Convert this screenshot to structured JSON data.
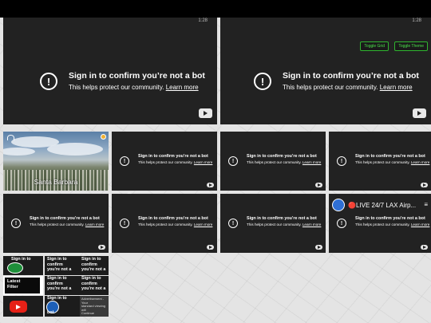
{
  "time_label": "1:28",
  "player": {
    "title": "Sign in to confirm you’re not a bot",
    "sub": "This helps protect our community.",
    "link": "Learn more"
  },
  "controls": {
    "toggle_grid": "Toggle Grid",
    "toggle_theme": "Toggle Theme"
  },
  "santa_barbara": {
    "caption": "Santa Barbara"
  },
  "lax": {
    "title": "🔴LIVE 24/7 LAX Airp...",
    "menu": "≡"
  },
  "mini": {
    "sign_in": "Sign in to",
    "confirm": "confirm",
    "not_bot": "you're not a",
    "bot": "bot",
    "latest": "Latest",
    "filter": "Filter",
    "advert": "Advertisement - Your",
    "advert2": "standard viewing will",
    "advert3": "Continue"
  },
  "colors": {
    "accent_green": "#2fb52f",
    "tile": "#222222",
    "yt_red": "#e62117"
  }
}
